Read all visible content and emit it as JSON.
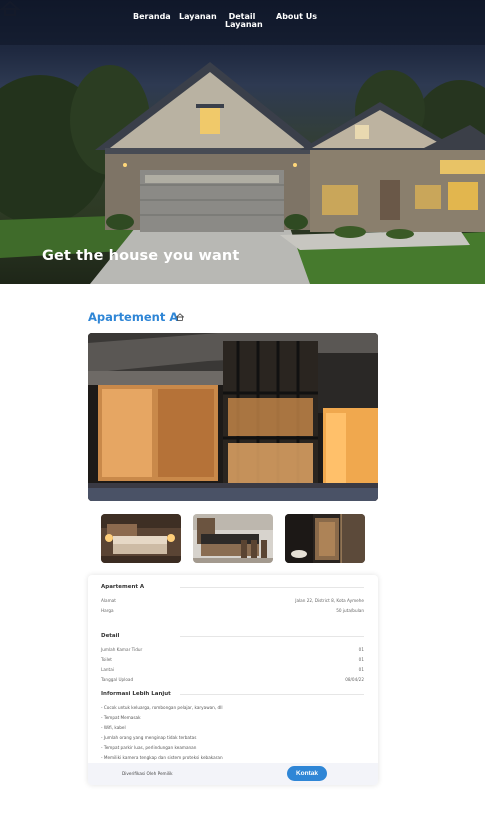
{
  "nav": {
    "items": [
      "Beranda",
      "Layanan",
      "Detail Layanan",
      "About Us"
    ]
  },
  "hero": {
    "title": "Get the house you want"
  },
  "listing": {
    "title": "Apartement A",
    "icon": "home-icon"
  },
  "card": {
    "name": "Apartement A",
    "alamat_label": "Alamat",
    "alamat_value": "Jalan 22, District 8, Kota Aymehe",
    "harga_label": "Harga",
    "harga_value": "50 juta/bulan",
    "detail_title": "Detail",
    "details": [
      {
        "label": "Jumlah Kamar Tidur",
        "value": "01"
      },
      {
        "label": "Toilet",
        "value": "01"
      },
      {
        "label": "Lantai",
        "value": "01"
      },
      {
        "label": "Tanggal Upload",
        "value": "08/04/22"
      }
    ],
    "info_title": "Informasi Lebih Lanjut",
    "info": [
      "- Cocok untuk keluarga, rombongan pelajar, karyawan, dll",
      "- Tempat Memasak",
      "- Wifi, kabel",
      "- Jumlah orang yang menginap tidak terbatas",
      "- Tempat parkir luas, perlindungan keamanan",
      "- Memiliki kamera tengkap dan sistem proteksi kebakaran"
    ],
    "verified": "Diverifikasi Oleh Pemilik",
    "contact_label": "Kontak"
  },
  "colors": {
    "accent": "#2f86d6",
    "footer_bg": "#f3f4f9"
  }
}
